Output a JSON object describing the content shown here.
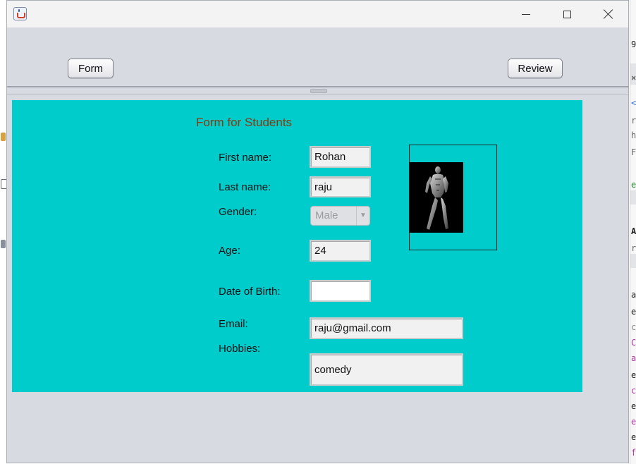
{
  "window": {
    "app_icon": "java-cup-icon"
  },
  "toolbar": {
    "form_label": "Form",
    "review_label": "Review"
  },
  "form": {
    "title": "Form for Students",
    "first_name_label": "First name:",
    "first_name_value": "Rohan",
    "last_name_label": "Last name:",
    "last_name_value": "raju",
    "gender_label": "Gender:",
    "gender_value": "Male",
    "age_label": "Age:",
    "age_value": "24",
    "dob_label": "Date of Birth:",
    "dob_value": "",
    "email_label": "Email:",
    "email_value": "raju@gmail.com",
    "hobbies_label": "Hobbies:",
    "hobbies_value": "comedy"
  },
  "colors": {
    "panel_bg": "#00cccc",
    "title_color": "#8b3a0e",
    "window_bg": "#d8dae2"
  }
}
